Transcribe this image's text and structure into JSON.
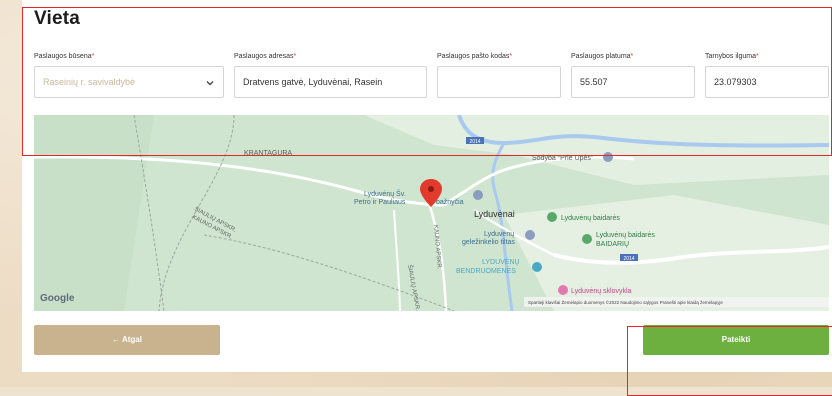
{
  "section": {
    "title": "Vieta"
  },
  "fields": {
    "status": {
      "label": "Paslaugos būsena",
      "value": "Raseinių r. savivaldybė"
    },
    "address": {
      "label": "Paslaugos adresas",
      "value": "Dratvens gatvė, Lyduvėnai, Rasein"
    },
    "postal": {
      "label": "Paslaugos pašto kodas",
      "value": ""
    },
    "lat": {
      "label": "Paslaugos platuma",
      "value": "55.507"
    },
    "lng": {
      "label": "Tarnybos ilguma",
      "value": "23.079303"
    },
    "required_mark": "*"
  },
  "map": {
    "labels": {
      "krantagura": "KRANTAGURA",
      "church1": "Lyduvėnų Šv.",
      "church2": "Petro ir Pauliaus",
      "church3": "bažnyčia",
      "town": "Lyduvėnai",
      "sodyba": "Sodyba \"Prie Upės\"",
      "baidares1": "Lyduvėnų baidarės",
      "baidares2": "Lyduvėnų baidarės",
      "baidares3": "BAIDARIŲ",
      "bridge1": "Lyduvėnų",
      "bridge2": "geležinkelio tiltas",
      "bend1": "LYDUVĖNŲ",
      "bend2": "BENDRUOMENĖS",
      "silo": "Lyduvėnų sklovykla",
      "siauliu": "ŠIAULIŲ APSKR.",
      "kauno": "KAUNO APSKR.",
      "siauliu2": "ŠIAULIŲ APSKR.",
      "kauno2": "KAUNO APSKR.",
      "road1": "2014",
      "road2": "2014",
      "google": "Google",
      "footer": "Spartieji klavišai   Žemėlapio duomenys ©2022   Naudojimo sąlygos   Pranešti apie klaidą žemėlapyje"
    }
  },
  "buttons": {
    "back": "← Atgal",
    "submit": "Pateikti"
  },
  "colors": {
    "accent_back": "#c9b38f",
    "accent_submit": "#6eb03f",
    "highlight": "#e0282a"
  }
}
